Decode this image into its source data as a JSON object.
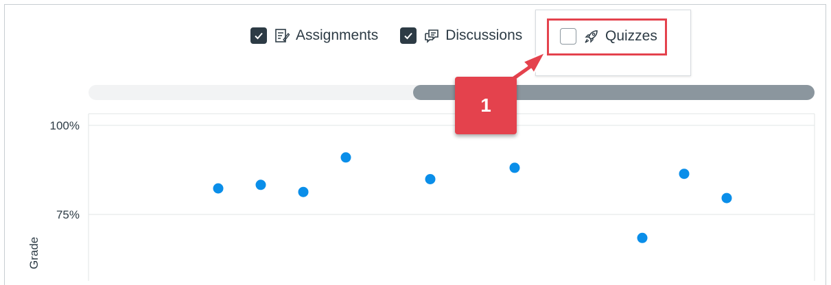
{
  "filters": [
    {
      "label": "Assignments",
      "checked": true,
      "icon": "assignment-icon"
    },
    {
      "label": "Discussions",
      "checked": true,
      "icon": "discussion-icon"
    },
    {
      "label": "Quizzes",
      "checked": false,
      "icon": "rocket-quiz-icon"
    }
  ],
  "callout": {
    "number": "1"
  },
  "scrollbar": {
    "thumb_start_fraction": 0.447,
    "thumb_end_fraction": 1.0
  },
  "colors": {
    "accent": "#0a8ee9",
    "callout": "#e4424d",
    "text": "#2d3b45",
    "scroll_thumb": "#8b969e"
  },
  "chart_data": {
    "type": "scatter",
    "title": "",
    "xlabel": "",
    "ylabel": "Grade",
    "y_ticks": [
      "100%",
      "75%"
    ],
    "ylim": [
      60,
      100
    ],
    "grid": true,
    "series": [
      {
        "x": [
          1,
          2,
          3,
          4,
          5,
          6,
          7,
          8,
          9
        ],
        "y": [
          82.3,
          83.3,
          81.3,
          91.0,
          84.9,
          88.1,
          68.4,
          86.4,
          79.6
        ]
      }
    ]
  }
}
